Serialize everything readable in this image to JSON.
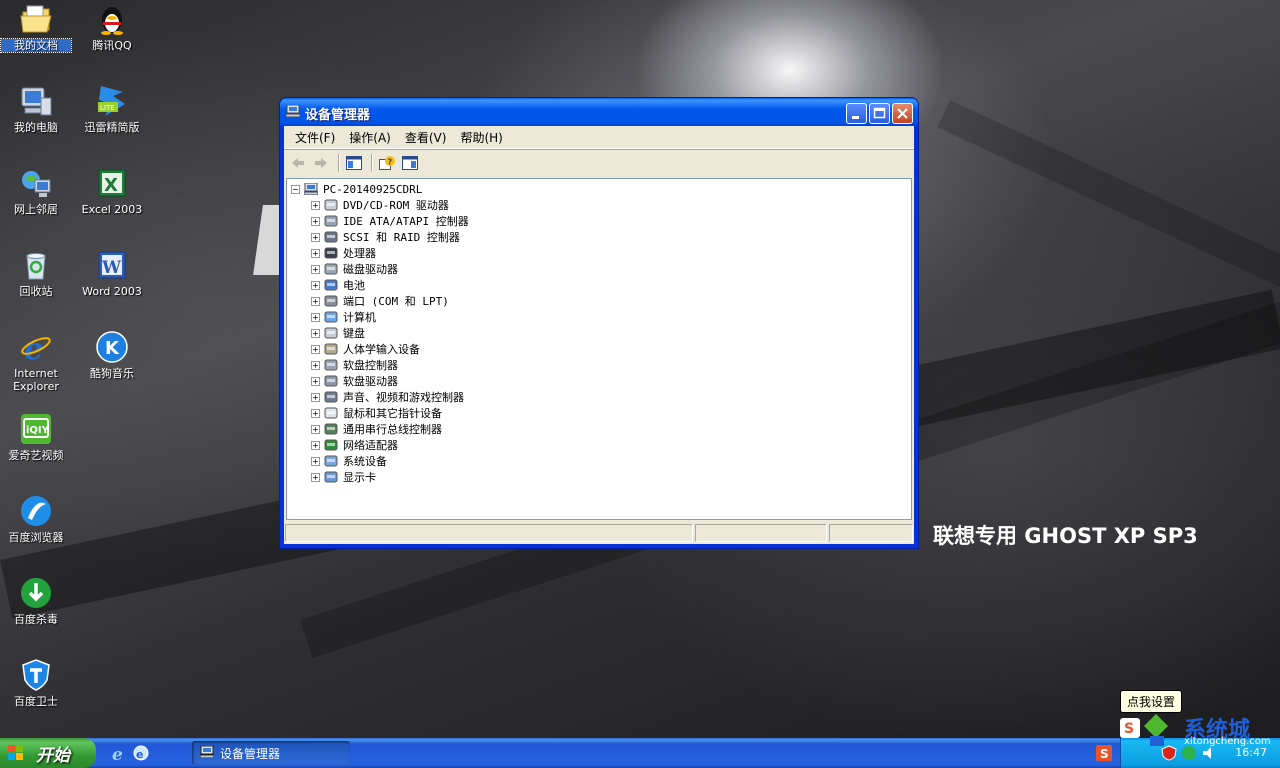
{
  "desktop": {
    "icons": [
      {
        "label": "我的文档",
        "icon": "my-documents-icon"
      },
      {
        "label": "腾讯QQ",
        "icon": "qq-penguin-icon"
      },
      {
        "label": "我的电脑",
        "icon": "my-computer-icon"
      },
      {
        "label": "迅雷精简版",
        "icon": "thunder-lite-icon"
      },
      {
        "label": "网上邻居",
        "icon": "network-places-icon"
      },
      {
        "label": "Excel 2003",
        "icon": "excel-icon"
      },
      {
        "label": "回收站",
        "icon": "recycle-bin-icon"
      },
      {
        "label": "Word 2003",
        "icon": "word-icon"
      },
      {
        "label": "Internet\nExplorer",
        "icon": "internet-explorer-icon"
      },
      {
        "label": "酷狗音乐",
        "icon": "kugou-music-icon"
      },
      {
        "label": "爱奇艺视频",
        "icon": "iqiyi-icon"
      },
      {
        "label": "百度浏览器",
        "icon": "baidu-browser-icon"
      },
      {
        "label": "百度杀毒",
        "icon": "baidu-antivirus-icon"
      },
      {
        "label": "百度卫士",
        "icon": "baidu-guard-icon"
      }
    ],
    "brand_text": "联想专用 GHOST XP SP3"
  },
  "window": {
    "title": "设备管理器",
    "menu": [
      "文件(F)",
      "操作(A)",
      "查看(V)",
      "帮助(H)"
    ],
    "toolbar_icons": [
      "back-arrow-icon",
      "forward-arrow-icon",
      "show-hide-tree-icon",
      "properties-help-icon",
      "details-pane-icon"
    ],
    "tree": {
      "root": "PC-20140925CDRL",
      "items": [
        "DVD/CD-ROM 驱动器",
        "IDE ATA/ATAPI 控制器",
        "SCSI 和 RAID 控制器",
        "处理器",
        "磁盘驱动器",
        "电池",
        "端口 (COM 和 LPT)",
        "计算机",
        "键盘",
        "人体学输入设备",
        "软盘控制器",
        "软盘驱动器",
        "声音、视频和游戏控制器",
        "鼠标和其它指针设备",
        "通用串行总线控制器",
        "网络适配器",
        "系统设备",
        "显示卡"
      ],
      "expander_symbol": "+",
      "root_expander_symbol": "−"
    }
  },
  "taskbar": {
    "start_label": "开始",
    "task_button": "设备管理器",
    "tooltip": "点我设置",
    "clock": "16:47",
    "watermark_text": "系统城",
    "watermark_url": "xitongcheng.com"
  },
  "colors": {
    "taskbar_blue": "#2663e0",
    "start_green": "#339933",
    "title_blue": "#0055e5"
  }
}
